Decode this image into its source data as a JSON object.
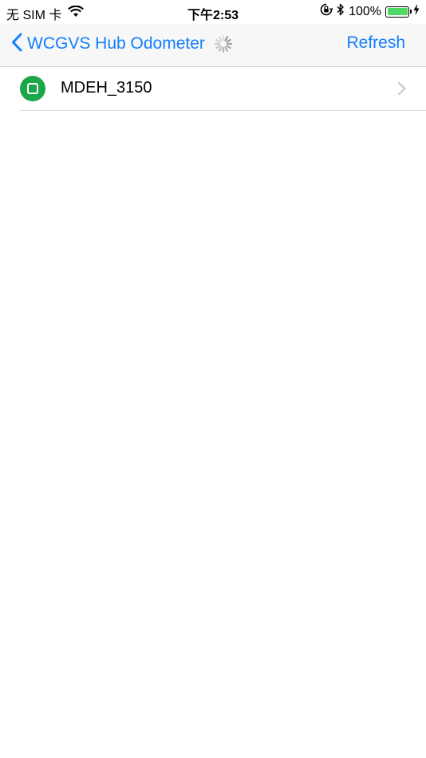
{
  "status_bar": {
    "carrier": "无 SIM 卡",
    "time": "下午2:53",
    "battery_percent": "100%",
    "battery_level": 1.0,
    "icons": [
      "wifi-icon",
      "orientation-lock-icon",
      "bluetooth-icon",
      "battery-icon",
      "charging-bolt-icon"
    ]
  },
  "nav": {
    "back_label": "WCGVS Hub Odometer",
    "refresh_label": "Refresh",
    "loading": true
  },
  "devices": [
    {
      "name": "MDEH_3150",
      "icon": "device-icon"
    }
  ],
  "colors": {
    "accent": "#147efb",
    "device_icon": "#1ca64a",
    "battery_fill": "#4cd964",
    "nav_background": "#f7f7f7"
  }
}
